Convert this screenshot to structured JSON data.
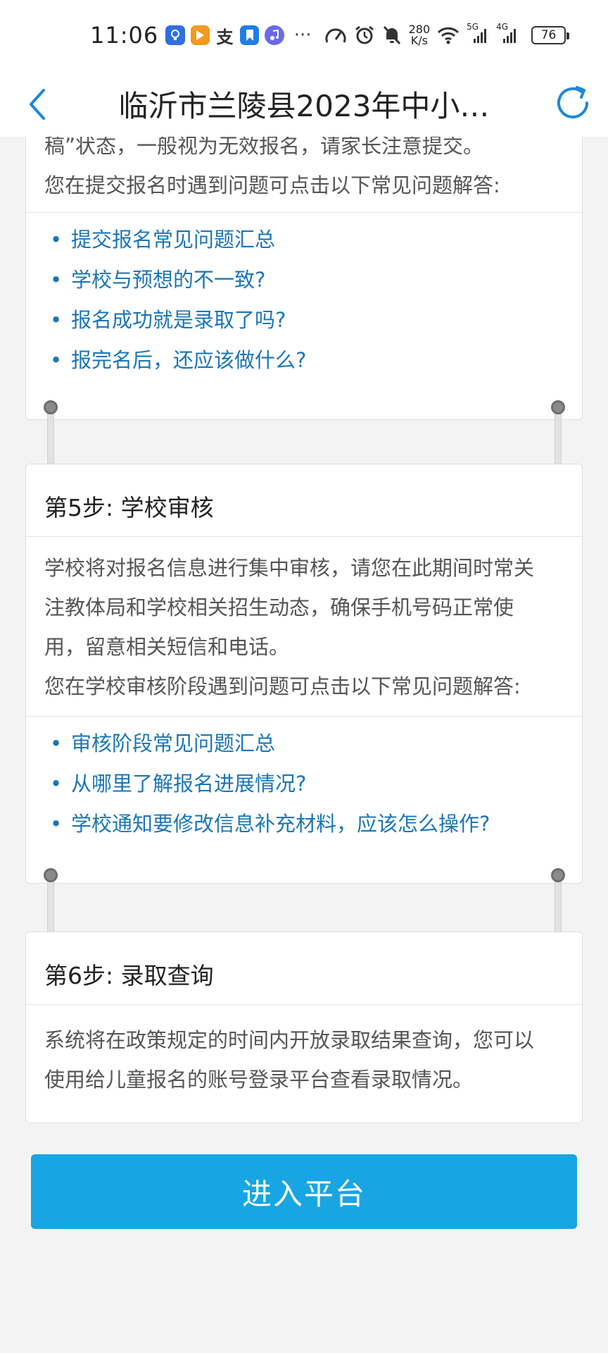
{
  "statusbar": {
    "time": "11:06",
    "speed_value": "280",
    "speed_unit": "K/s",
    "signal1": "5G",
    "signal2": "4G",
    "battery": "76",
    "more": "···"
  },
  "nav": {
    "title": "临沂市兰陵县2023年中小…"
  },
  "card_step4_tail": {
    "text1": "稿”状态，一般视为无效报名，请家长注意提交。",
    "text2": "您在提交报名时遇到问题可点击以下常见问题解答:",
    "links": [
      "提交报名常见问题汇总",
      "学校与预想的不一致?",
      "报名成功就是录取了吗?",
      "报完名后，还应该做什么?"
    ]
  },
  "step5": {
    "title": "第5步:  学校审核",
    "text_lines": [
      "学校将对报名信息进行集中审核，请您在此期间时常关",
      "注教体局和学校相关招生动态，确保手机号码正常使",
      "用，留意相关短信和电话。",
      "您在学校审核阶段遇到问题可点击以下常见问题解答:"
    ],
    "links": [
      "审核阶段常见问题汇总",
      "从哪里了解报名进展情况?",
      "学校通知要修改信息补充材料，应该怎么操作?"
    ]
  },
  "step6": {
    "title": "第6步:  录取查询",
    "text_lines": [
      "系统将在政策规定的时间内开放录取结果查询，您可以",
      "使用给儿童报名的账号登录平台查看录取情况。"
    ]
  },
  "button": {
    "label": "进入平台"
  },
  "colors": {
    "link": "#1a76b8",
    "button": "#17a6e3",
    "nav_icon": "#1e88d8"
  }
}
